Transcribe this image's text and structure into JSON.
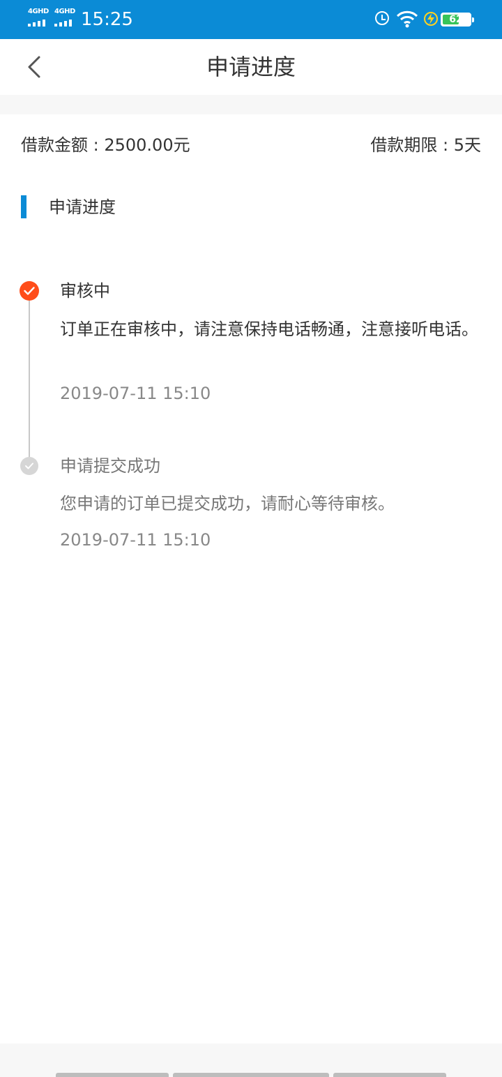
{
  "status_bar": {
    "network_1": "4GHD",
    "network_2": "4GHD",
    "time": "15:25",
    "battery_level": "62",
    "battery_fraction": 0.62
  },
  "header": {
    "title": "申请进度"
  },
  "loan": {
    "amount": "借款金额 : 2500.00元",
    "term": "借款期限 : 5天"
  },
  "section": {
    "label": "申请进度"
  },
  "steps": [
    {
      "title": "审核中",
      "desc": "订单正在审核中，请注意保持电话畅通，注意接听电话。",
      "time": "2019-07-11 15:10",
      "state": "active"
    },
    {
      "title": "申请提交成功",
      "desc": "您申请的订单已提交成功，请耐心等待审核。",
      "time": "2019-07-11 15:10",
      "state": "done"
    }
  ],
  "colors": {
    "status_bar": "#0b8bd6",
    "accent_bar": "#0b8bd6",
    "active_dot": "#ff4d1a",
    "inactive_dot": "#d6d6d6",
    "battery_fill": "#37c45a"
  }
}
